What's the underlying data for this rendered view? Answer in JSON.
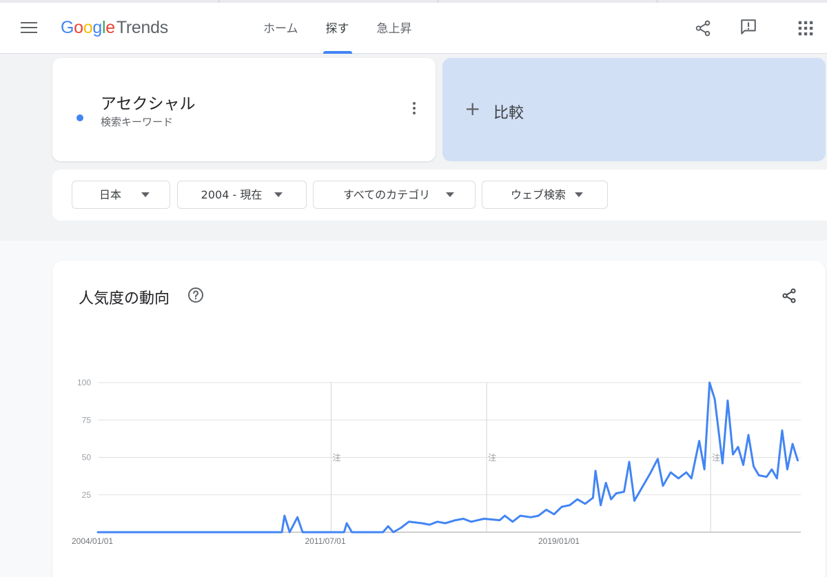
{
  "header": {
    "logo_google": "Google",
    "logo_trends": "Trends",
    "tabs": [
      {
        "label": "ホーム",
        "active": false
      },
      {
        "label": "探す",
        "active": true
      },
      {
        "label": "急上昇",
        "active": false
      }
    ],
    "icons": [
      "menu-icon",
      "share-icon",
      "feedback-icon",
      "apps-icon"
    ]
  },
  "term": {
    "name": "アセクシャル",
    "subtitle": "検索キーワード",
    "color": "#4285f4"
  },
  "compare": {
    "plus": "+",
    "label": "比較"
  },
  "filters": [
    {
      "label": "日本"
    },
    {
      "label": "2004 - 現在"
    },
    {
      "label": "すべてのカテゴリ"
    },
    {
      "label": "ウェブ検索"
    }
  ],
  "chart_card": {
    "title": "人気度の動向"
  },
  "chart_data": {
    "type": "line",
    "title": "人気度の動向",
    "xlabel": "",
    "ylabel": "",
    "ylim": [
      0,
      100
    ],
    "yticks": [
      25,
      50,
      75,
      100
    ],
    "xtick_labels": [
      "2004/01/01",
      "2011/07/01",
      "2019/01/01"
    ],
    "annotation_label": "注",
    "grid": true,
    "series": [
      {
        "color": "#4285f4",
        "points": [
          [
            "2004-01",
            0
          ],
          [
            "2009-12",
            0
          ],
          [
            "2010-01",
            11
          ],
          [
            "2010-03",
            0
          ],
          [
            "2010-06",
            10
          ],
          [
            "2010-08",
            0
          ],
          [
            "2011-12",
            0
          ],
          [
            "2012-01",
            6
          ],
          [
            "2012-03",
            0
          ],
          [
            "2013-03",
            0
          ],
          [
            "2013-05",
            4
          ],
          [
            "2013-07",
            0
          ],
          [
            "2013-10",
            3
          ],
          [
            "2014-01",
            7
          ],
          [
            "2014-06",
            6
          ],
          [
            "2014-09",
            5
          ],
          [
            "2014-12",
            7
          ],
          [
            "2015-03",
            6
          ],
          [
            "2015-07",
            8
          ],
          [
            "2015-10",
            9
          ],
          [
            "2016-01",
            7
          ],
          [
            "2016-06",
            9
          ],
          [
            "2016-12",
            8
          ],
          [
            "2017-02",
            11
          ],
          [
            "2017-05",
            7
          ],
          [
            "2017-08",
            11
          ],
          [
            "2017-12",
            10
          ],
          [
            "2018-03",
            11
          ],
          [
            "2018-06",
            15
          ],
          [
            "2018-09",
            12
          ],
          [
            "2018-12",
            17
          ],
          [
            "2019-03",
            18
          ],
          [
            "2019-06",
            22
          ],
          [
            "2019-09",
            19
          ],
          [
            "2019-12",
            23
          ],
          [
            "2020-01",
            41
          ],
          [
            "2020-03",
            18
          ],
          [
            "2020-05",
            33
          ],
          [
            "2020-07",
            22
          ],
          [
            "2020-09",
            26
          ],
          [
            "2020-12",
            27
          ],
          [
            "2021-02",
            47
          ],
          [
            "2021-04",
            21
          ],
          [
            "2021-07",
            30
          ],
          [
            "2021-10",
            39
          ],
          [
            "2022-01",
            49
          ],
          [
            "2022-03",
            31
          ],
          [
            "2022-06",
            40
          ],
          [
            "2022-09",
            36
          ],
          [
            "2022-12",
            40
          ],
          [
            "2023-02",
            36
          ],
          [
            "2023-05",
            61
          ],
          [
            "2023-07",
            42
          ],
          [
            "2023-09",
            100
          ],
          [
            "2023-11",
            89
          ],
          [
            "2024-02",
            46
          ],
          [
            "2024-04",
            88
          ],
          [
            "2024-06",
            52
          ],
          [
            "2024-08",
            57
          ],
          [
            "2024-10",
            45
          ],
          [
            "2024-12",
            65
          ],
          [
            "2025-02",
            44
          ],
          [
            "2025-04",
            38
          ],
          [
            "2025-07",
            37
          ],
          [
            "2025-09",
            42
          ],
          [
            "2025-11",
            36
          ],
          [
            "2026-01",
            68
          ],
          [
            "2026-03",
            42
          ],
          [
            "2026-05",
            59
          ],
          [
            "2026-07",
            48
          ]
        ]
      }
    ]
  }
}
